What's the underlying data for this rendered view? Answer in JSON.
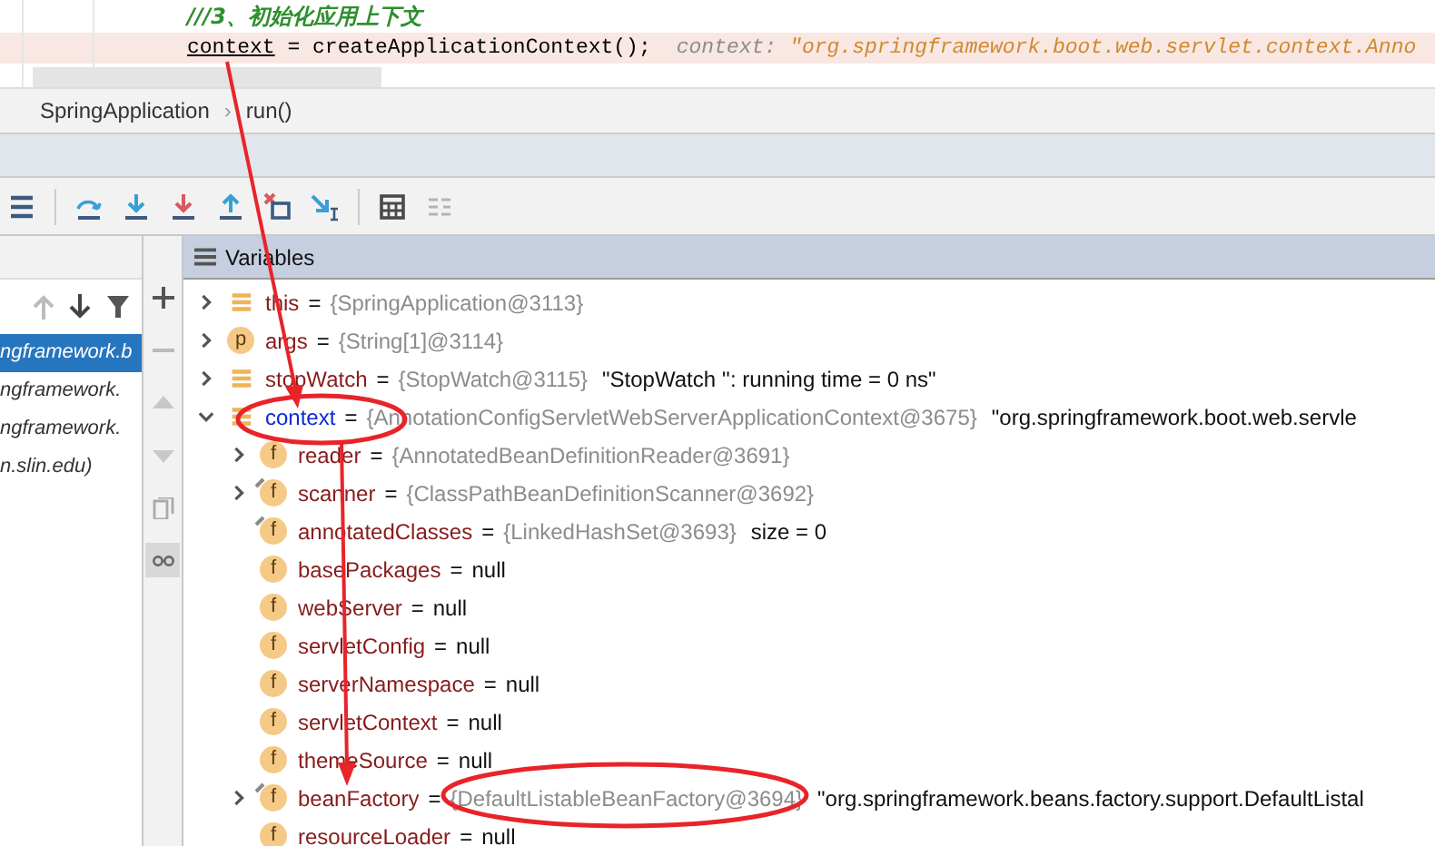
{
  "editor": {
    "lines": [
      {
        "kind": "comment",
        "highlighted": false,
        "text": "///3、初始化应用上下文"
      },
      {
        "kind": "code",
        "highlighted": true,
        "code": [
          {
            "text": "context",
            "underlined": true
          },
          {
            "text": " = createApplicationContext();",
            "underlined": false
          }
        ],
        "hint_label": "context:",
        "hint_value": "\"org.springframework.boot.web.servlet.context.Anno"
      }
    ]
  },
  "breadcrumb": {
    "items": [
      "SpringApplication",
      "run()"
    ],
    "separator": "›"
  },
  "frames": {
    "items": [
      {
        "label": "ngframework.b",
        "selected": true
      },
      {
        "label": "ngframework.",
        "selected": false
      },
      {
        "label": "ngframework.",
        "selected": false
      },
      {
        "label": "n.slin.edu)",
        "selected": false
      }
    ]
  },
  "variables": {
    "title": "Variables",
    "rows": [
      {
        "kind": "local",
        "name": "this",
        "sep": "=",
        "ref": "{SpringApplication@3113}",
        "expandable": true,
        "expanded": false,
        "changed": false,
        "final": false
      },
      {
        "kind": "param",
        "badge": "p",
        "name": "args",
        "sep": "=",
        "ref": "{String[1]@3114}",
        "expandable": true,
        "expanded": false,
        "changed": false,
        "final": false
      },
      {
        "kind": "local",
        "name": "stopWatch",
        "sep": "=",
        "ref": "{StopWatch@3115}",
        "value": "\"StopWatch '': running time = 0 ns\"",
        "expandable": true,
        "expanded": false,
        "changed": false,
        "final": false
      },
      {
        "kind": "local",
        "name": "context",
        "sep": "=",
        "ref": "{AnnotationConfigServletWebServerApplicationContext@3675}",
        "value": "\"org.springframework.boot.web.servle",
        "expandable": true,
        "expanded": true,
        "changed": true,
        "final": false,
        "children": [
          {
            "kind": "field",
            "badge": "f",
            "name": "reader",
            "sep": "=",
            "ref": "{AnnotatedBeanDefinitionReader@3691}",
            "expandable": true,
            "expanded": false,
            "changed": false,
            "final": false
          },
          {
            "kind": "field",
            "badge": "f",
            "name": "scanner",
            "sep": "=",
            "ref": "{ClassPathBeanDefinitionScanner@3692}",
            "expandable": true,
            "expanded": false,
            "changed": false,
            "final": true
          },
          {
            "kind": "field",
            "badge": "f",
            "name": "annotatedClasses",
            "sep": "=",
            "ref": "{LinkedHashSet@3693}",
            "value": "size = 0",
            "expandable": false,
            "changed": false,
            "final": true
          },
          {
            "kind": "field",
            "badge": "f",
            "name": "basePackages",
            "sep": "=",
            "value": "null",
            "expandable": false,
            "changed": false,
            "final": false
          },
          {
            "kind": "field",
            "badge": "f",
            "name": "webServer",
            "sep": "=",
            "value": "null",
            "expandable": false,
            "changed": false,
            "final": false
          },
          {
            "kind": "field",
            "badge": "f",
            "name": "servletConfig",
            "sep": "=",
            "value": "null",
            "expandable": false,
            "changed": false,
            "final": false
          },
          {
            "kind": "field",
            "badge": "f",
            "name": "serverNamespace",
            "sep": "=",
            "value": "null",
            "expandable": false,
            "changed": false,
            "final": false
          },
          {
            "kind": "field",
            "badge": "f",
            "name": "servletContext",
            "sep": "=",
            "value": "null",
            "expandable": false,
            "changed": false,
            "final": false
          },
          {
            "kind": "field",
            "badge": "f",
            "name": "themeSource",
            "sep": "=",
            "value": "null",
            "expandable": false,
            "changed": false,
            "final": false
          },
          {
            "kind": "field",
            "badge": "f",
            "name": "beanFactory",
            "sep": "=",
            "ref": "{DefaultListableBeanFactory@3694}",
            "value": "\"org.springframework.beans.factory.support.DefaultListal",
            "expandable": true,
            "expanded": false,
            "changed": false,
            "final": true
          },
          {
            "kind": "field",
            "badge": "f",
            "name": "resourceLoader",
            "sep": "=",
            "value": "null",
            "expandable": false,
            "changed": false,
            "final": false
          }
        ]
      }
    ]
  }
}
